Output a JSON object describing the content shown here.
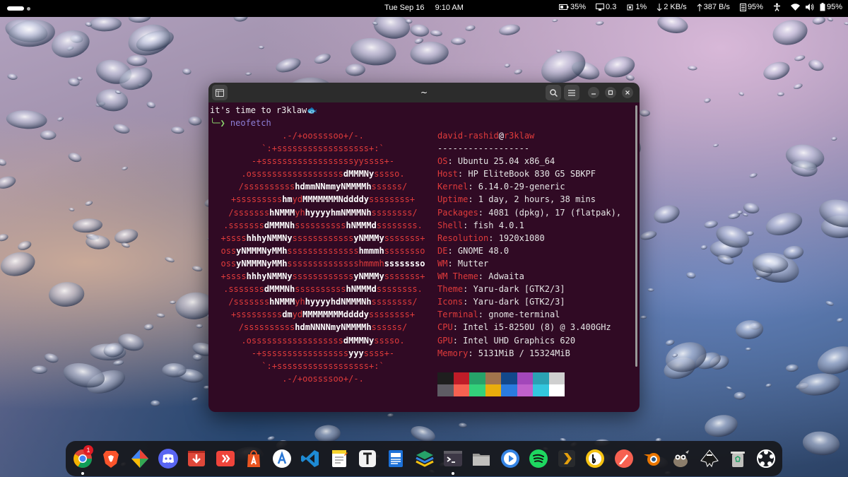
{
  "topbar": {
    "date": "Tue Sep 16",
    "time": "9:10 AM",
    "tray": {
      "battery_left": "35%",
      "load": "0.3",
      "cpu": "1%",
      "download": "2 KB/s",
      "upload": "387 B/s",
      "memory": "95%",
      "battery_right": "95%"
    }
  },
  "terminal": {
    "title": "~",
    "greeting": "it's time to r3klaw🐟",
    "command": "neofetch",
    "user": "david-rashid",
    "at": "@",
    "host": "r3klaw",
    "separator": "------------------",
    "info": [
      {
        "key": "OS",
        "value": ": Ubuntu 25.04 x86_64"
      },
      {
        "key": "Host",
        "value": ": HP EliteBook 830 G5 SBKPF"
      },
      {
        "key": "Kernel",
        "value": ": 6.14.0-29-generic"
      },
      {
        "key": "Uptime",
        "value": ": 1 day, 2 hours, 38 mins"
      },
      {
        "key": "Packages",
        "value": ": 4081 (dpkg), 17 (flatpak),"
      },
      {
        "key": "Shell",
        "value": ": fish 4.0.1"
      },
      {
        "key": "Resolution",
        "value": ": 1920x1080"
      },
      {
        "key": "DE",
        "value": ": GNOME 48.0"
      },
      {
        "key": "WM",
        "value": ": Mutter"
      },
      {
        "key": "WM Theme",
        "value": ": Adwaita"
      },
      {
        "key": "Theme",
        "value": ": Yaru-dark [GTK2/3]"
      },
      {
        "key": "Icons",
        "value": ": Yaru-dark [GTK2/3]"
      },
      {
        "key": "Terminal",
        "value": ": gnome-terminal"
      },
      {
        "key": "CPU",
        "value": ": Intel i5-8250U (8) @ 3.400GHz"
      },
      {
        "key": "GPU",
        "value": ": Intel UHD Graphics 620"
      },
      {
        "key": "Memory",
        "value": ": 5131MiB / 15324MiB"
      }
    ],
    "ascii_logo": [
      [
        ".-/+oossssoo+/-.",
        ""
      ],
      [
        "`:+ssssssssssssssssss+:`",
        ""
      ],
      [
        "-+ssssssssssssssssssyyssss+-",
        ""
      ],
      [
        ".ossssssssssssssssss",
        "dMMMNy",
        "sssso."
      ],
      [
        "/ssssssssss",
        "hdmmNNmmyNMMMMh",
        "ssssss/"
      ],
      [
        "+sssssssss",
        "hm",
        "yd",
        "MMMMMMMNddddy",
        "ssssssss+"
      ],
      [
        "/sssssss",
        "hNMMM",
        "yh",
        "hyyyyhmNMMMNh",
        "ssssssss/"
      ],
      [
        ".sssssss",
        "dMMMNh",
        "ssssssssss",
        "hNMMMd",
        "ssssssss."
      ],
      [
        "+ssss",
        "hhhyNMMNy",
        "ssssssssssss",
        "yNMMMy",
        "sssssss+"
      ],
      [
        "oss",
        "yNMMMNyMMh",
        "ssssssssssssss",
        "hmmmh",
        "ssssssso"
      ],
      [
        "oss",
        "yNMMMNyMMh",
        "sssssssssssssshmmmh",
        "ssssssso"
      ],
      [
        "+ssss",
        "hhhyNMMNy",
        "ssssssssssss",
        "yNMMMy",
        "sssssss+"
      ],
      [
        ".sssssss",
        "dMMMNh",
        "ssssssssss",
        "hNMMMd",
        "ssssssss."
      ],
      [
        "/sssssss",
        "hNMMM",
        "yh",
        "hyyyyhdNMMMNh",
        "ssssssss/"
      ],
      [
        "+sssssssss",
        "dm",
        "yd",
        "MMMMMMMMddddy",
        "ssssssss+"
      ],
      [
        "/ssssssssss",
        "hdmNNNNmyNMMMMh",
        "ssssss/"
      ],
      [
        ".ossssssssssssssssss",
        "dMMMNy",
        "sssso."
      ],
      [
        "-+sssssssssssssssss",
        "yyy",
        "ssss+-"
      ],
      [
        "`:+ssssssssssssssssss+:`",
        ""
      ],
      [
        ".-/+oossssoo+/-.",
        ""
      ]
    ],
    "palette": [
      "#1e1e1e",
      "#c01c28",
      "#26a269",
      "#a2734c",
      "#12488b",
      "#a347ba",
      "#2aa1b3",
      "#cfcfcf",
      "#5e5c64",
      "#f66151",
      "#33d17a",
      "#e9ad0c",
      "#2a7bde",
      "#c061cb",
      "#33c7de",
      "#ffffff"
    ]
  },
  "dock": {
    "apps": [
      {
        "name": "chrome-icon",
        "badge": "1"
      },
      {
        "name": "brave-icon"
      },
      {
        "name": "gemini-icon"
      },
      {
        "name": "discord-icon"
      },
      {
        "name": "video-downloader-icon"
      },
      {
        "name": "anydesk-icon"
      },
      {
        "name": "app-center-icon"
      },
      {
        "name": "appimage-icon"
      },
      {
        "name": "vscode-icon"
      },
      {
        "name": "text-editor-icon"
      },
      {
        "name": "typora-icon"
      },
      {
        "name": "document-viewer-icon"
      },
      {
        "name": "layers-icon"
      },
      {
        "name": "terminal-icon"
      },
      {
        "name": "files-icon"
      },
      {
        "name": "media-player-icon"
      },
      {
        "name": "spotify-icon"
      },
      {
        "name": "plex-icon"
      },
      {
        "name": "b-icon"
      },
      {
        "name": "pen-icon"
      },
      {
        "name": "blender-icon"
      },
      {
        "name": "gimp-icon"
      },
      {
        "name": "inkscape-icon"
      },
      {
        "name": "trash-icon"
      },
      {
        "name": "show-apps-icon"
      }
    ]
  }
}
